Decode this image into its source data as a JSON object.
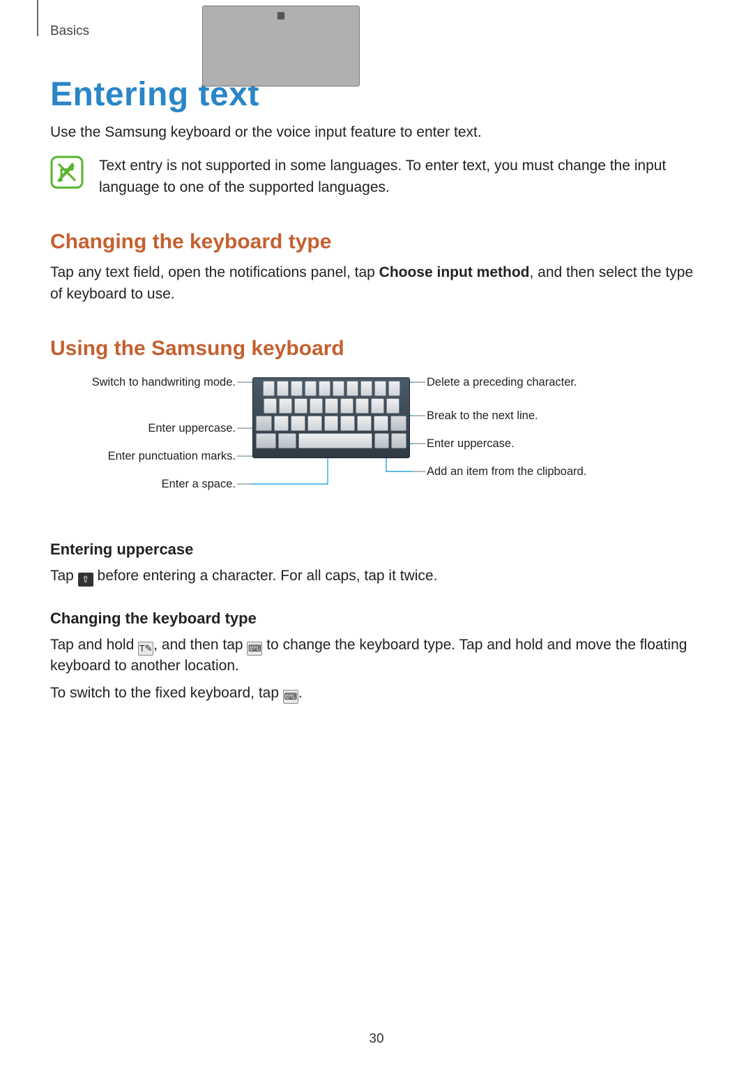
{
  "breadcrumb": "Basics",
  "h1": "Entering text",
  "intro": "Use the Samsung keyboard or the voice input feature to enter text.",
  "note": "Text entry is not supported in some languages. To enter text, you must change the input language to one of the supported languages.",
  "sections": {
    "changing_type": {
      "title": "Changing the keyboard type",
      "p_before": "Tap any text field, open the notifications panel, tap ",
      "bold": "Choose input method",
      "p_after": ", and then select the type of keyboard to use."
    },
    "using": {
      "title": "Using the Samsung keyboard"
    }
  },
  "labels": {
    "left": {
      "handwriting": "Switch to handwriting mode.",
      "upper": "Enter uppercase.",
      "punct": "Enter punctuation marks.",
      "space": "Enter a space."
    },
    "right": {
      "delete": "Delete a preceding character.",
      "nextline": "Break to the next line.",
      "upper": "Enter uppercase.",
      "clipboard": "Add an item from the clipboard."
    }
  },
  "sub": {
    "upper": {
      "title": "Entering uppercase",
      "before": "Tap ",
      "after": " before entering a character. For all caps, tap it twice."
    },
    "changing": {
      "title": "Changing the keyboard type",
      "p1a": "Tap and hold ",
      "p1b": ", and then tap ",
      "p1c": " to change the keyboard type. Tap and hold ",
      "p1d": " and move the floating keyboard to another location.",
      "p2a": "To switch to the fixed keyboard, tap ",
      "p2b": "."
    }
  },
  "page_number": "30"
}
